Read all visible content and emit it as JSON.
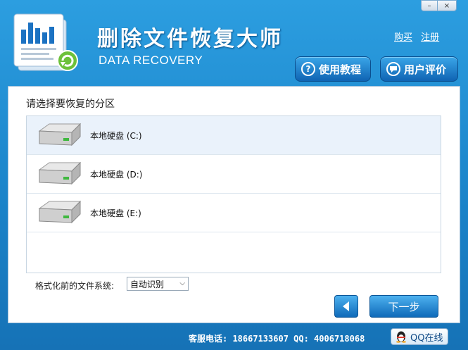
{
  "app": {
    "title_cn": "删除文件恢复大师",
    "title_en": "DATA RECOVERY"
  },
  "window_controls": {
    "minimize": "–",
    "close": "×"
  },
  "header_links": {
    "buy": "购买",
    "register": "注册"
  },
  "header_buttons": {
    "guide": {
      "label": "使用教程",
      "icon": "question-icon"
    },
    "review": {
      "label": "用户评价",
      "icon": "comment-icon"
    }
  },
  "main": {
    "prompt": "请选择要恢复的分区",
    "partitions": [
      {
        "label": "本地硬盘 (C:)",
        "selected": true
      },
      {
        "label": "本地硬盘 (D:)",
        "selected": false
      },
      {
        "label": "本地硬盘 (E:)",
        "selected": false
      }
    ],
    "fs_label": "格式化前的文件系统:",
    "fs_value": "自动识别",
    "back_icon": "triangle-left-icon",
    "next_label": "下一步"
  },
  "footer": {
    "contact": "客服电话: 18667133607 QQ: 4006718068",
    "qq_label": "QQ在线"
  },
  "colors": {
    "accent": "#1a82c8",
    "button": "#0f6ab9",
    "selected_row": "#eaf2fb"
  }
}
